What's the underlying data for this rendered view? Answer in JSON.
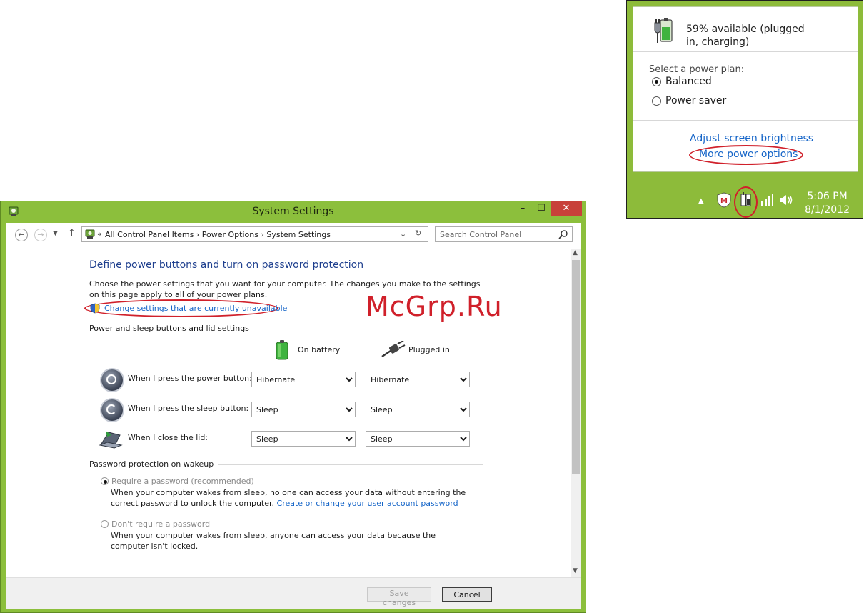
{
  "flyout": {
    "battery_status": "59% available (plugged in, charging)",
    "plan_label": "Select a power plan:",
    "plans": [
      {
        "label": "Balanced",
        "selected": true
      },
      {
        "label": "Power saver",
        "selected": false
      }
    ],
    "links": {
      "brightness": "Adjust screen brightness",
      "more_options": "More power options"
    },
    "clock": {
      "time": "5:06 PM",
      "date": "8/1/2012"
    },
    "taskbar_color": "#8dbb3a"
  },
  "window": {
    "title": "System Settings",
    "controls": {
      "minimize": "–",
      "maximize": "☐",
      "close": "✕"
    },
    "address": {
      "prefix": "«",
      "crumbs": [
        "All Control Panel Items",
        "Power Options",
        "System Settings"
      ]
    },
    "search": {
      "placeholder": "Search Control Panel"
    },
    "heading": "Define power buttons and turn on password protection",
    "intro": "Choose the power settings that you want for your computer. The changes you make to the settings on this page apply to all of your power plans.",
    "change_link": "Change settings that are currently unavailable",
    "group_buttons": "Power and sleep buttons and lid settings",
    "columns": {
      "battery": "On battery",
      "plugged": "Plugged in"
    },
    "rows": [
      {
        "label": "When I press the power button:",
        "battery": "Hibernate",
        "plugged": "Hibernate"
      },
      {
        "label": "When I press the sleep button:",
        "battery": "Sleep",
        "plugged": "Sleep"
      },
      {
        "label": "When I close the lid:",
        "battery": "Sleep",
        "plugged": "Sleep"
      }
    ],
    "group_password": "Password protection on wakeup",
    "password_options": [
      {
        "label": "Require a password (recommended)",
        "desc": "When your computer wakes from sleep, no one can access your data without entering the correct password to unlock the computer.",
        "link": "Create or change your user account password",
        "selected": true
      },
      {
        "label": "Don't require a password",
        "desc": "When your computer wakes from sleep, anyone can access your data because the computer isn't locked.",
        "selected": false
      }
    ],
    "buttons": {
      "save": "Save changes",
      "cancel": "Cancel"
    }
  },
  "watermark": "McGrp.Ru",
  "accent_color": "#8cbf3c",
  "highlight_color": "#d0202a"
}
